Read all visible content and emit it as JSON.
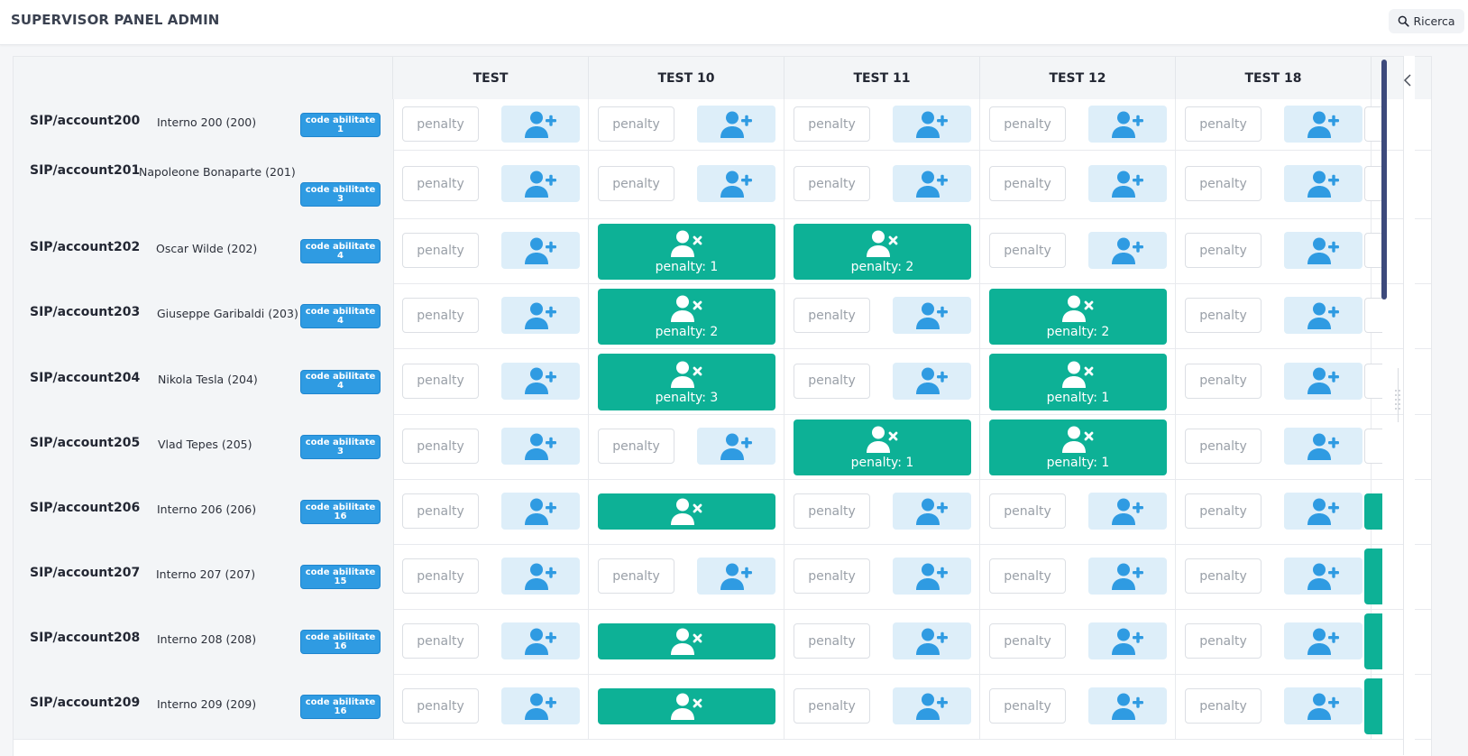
{
  "header": {
    "title": "SUPERVISOR PANEL ADMIN",
    "search_label": "Ricerca"
  },
  "columns": [
    "TEST",
    "TEST 10",
    "TEST 11",
    "TEST 12",
    "TEST 18"
  ],
  "penalty_placeholder": "penalty",
  "badge_label": "code abilitate",
  "rows": [
    {
      "account": "SIP/account200",
      "name": "Interno 200 (200)",
      "code_count": "1",
      "cells": [
        {
          "state": "empty"
        },
        {
          "state": "empty"
        },
        {
          "state": "empty"
        },
        {
          "state": "empty"
        },
        {
          "state": "empty"
        }
      ]
    },
    {
      "account": "SIP/account201",
      "name": "Napoleone Bonaparte (201)",
      "code_count": "3",
      "cells": [
        {
          "state": "empty"
        },
        {
          "state": "empty"
        },
        {
          "state": "empty"
        },
        {
          "state": "empty"
        },
        {
          "state": "empty"
        }
      ]
    },
    {
      "account": "SIP/account202",
      "name": "Oscar Wilde (202)",
      "code_count": "4",
      "cells": [
        {
          "state": "empty"
        },
        {
          "state": "assigned",
          "penalty": "penalty: 1"
        },
        {
          "state": "assigned",
          "penalty": "penalty: 2"
        },
        {
          "state": "empty"
        },
        {
          "state": "empty"
        }
      ]
    },
    {
      "account": "SIP/account203",
      "name": "Giuseppe Garibaldi (203)",
      "code_count": "4",
      "cells": [
        {
          "state": "empty"
        },
        {
          "state": "assigned",
          "penalty": "penalty: 2"
        },
        {
          "state": "empty"
        },
        {
          "state": "assigned",
          "penalty": "penalty: 2"
        },
        {
          "state": "empty"
        }
      ]
    },
    {
      "account": "SIP/account204",
      "name": "Nikola Tesla (204)",
      "code_count": "4",
      "cells": [
        {
          "state": "empty"
        },
        {
          "state": "assigned",
          "penalty": "penalty: 3"
        },
        {
          "state": "empty"
        },
        {
          "state": "assigned",
          "penalty": "penalty: 1"
        },
        {
          "state": "empty"
        }
      ]
    },
    {
      "account": "SIP/account205",
      "name": "Vlad Tepes (205)",
      "code_count": "3",
      "cells": [
        {
          "state": "empty"
        },
        {
          "state": "empty"
        },
        {
          "state": "assigned",
          "penalty": "penalty: 1"
        },
        {
          "state": "assigned",
          "penalty": "penalty: 1"
        },
        {
          "state": "empty"
        }
      ]
    },
    {
      "account": "SIP/account206",
      "name": "Interno 206 (206)",
      "code_count": "16",
      "cells": [
        {
          "state": "empty"
        },
        {
          "state": "assigned"
        },
        {
          "state": "empty"
        },
        {
          "state": "empty"
        },
        {
          "state": "empty"
        }
      ]
    },
    {
      "account": "SIP/account207",
      "name": "Interno 207 (207)",
      "code_count": "15",
      "cells": [
        {
          "state": "empty"
        },
        {
          "state": "empty"
        },
        {
          "state": "empty"
        },
        {
          "state": "empty"
        },
        {
          "state": "empty"
        }
      ]
    },
    {
      "account": "SIP/account208",
      "name": "Interno 208 (208)",
      "code_count": "16",
      "cells": [
        {
          "state": "empty"
        },
        {
          "state": "assigned"
        },
        {
          "state": "empty"
        },
        {
          "state": "empty"
        },
        {
          "state": "empty"
        }
      ]
    },
    {
      "account": "SIP/account209",
      "name": "Interno 209 (209)",
      "code_count": "16",
      "cells": [
        {
          "state": "empty"
        },
        {
          "state": "assigned"
        },
        {
          "state": "empty"
        },
        {
          "state": "empty"
        },
        {
          "state": "empty"
        }
      ]
    }
  ],
  "colors": {
    "assigned": "#0db196",
    "add_bg": "#ddeef9",
    "add_icon": "#2f9be2",
    "badge": "#2f9be2"
  }
}
